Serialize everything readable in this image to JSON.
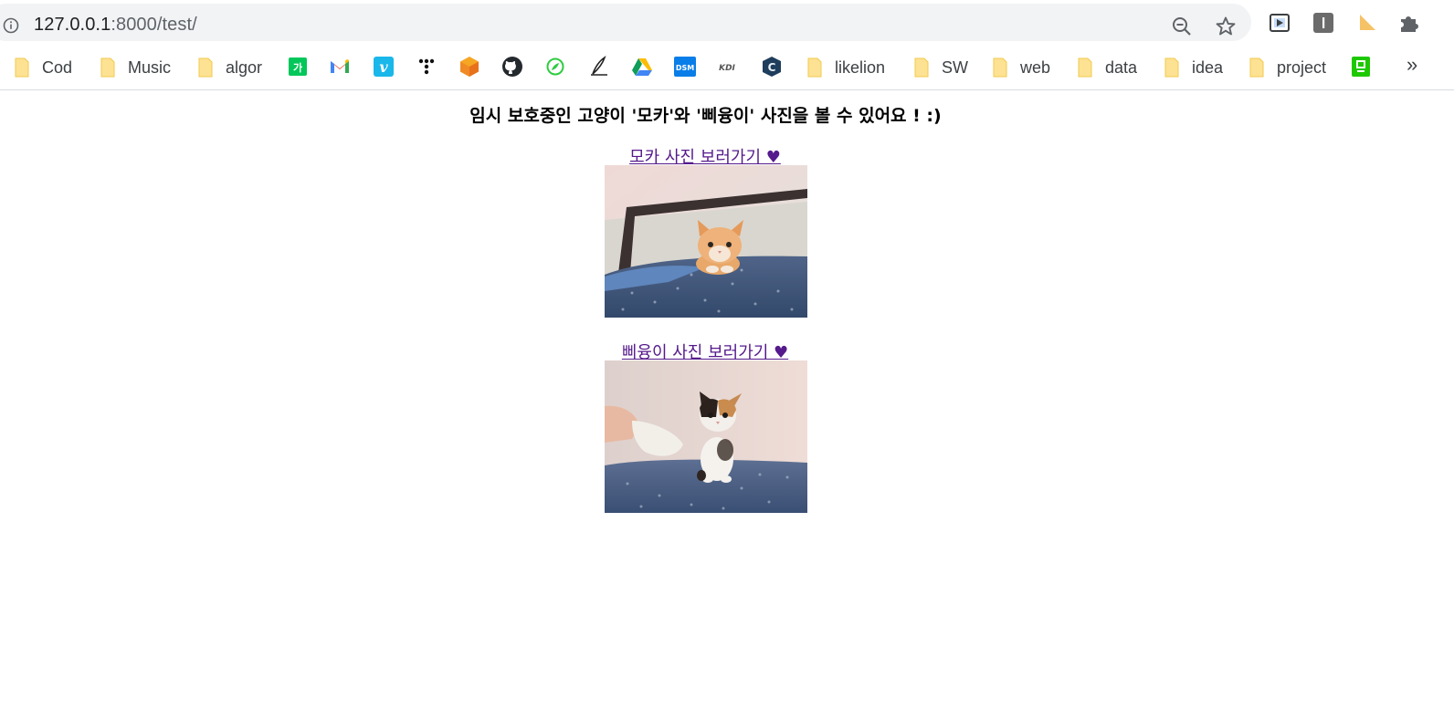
{
  "browser": {
    "url_host": "127.0.0.1",
    "url_rest": ":8000/test/",
    "toolbar_icons": [
      "zoom-out-icon",
      "bookmark-star-icon"
    ],
    "extension_icons": [
      "media-extension-icon",
      "i-extension-icon",
      "triangle-extension-icon",
      "puzzle-extensions-icon"
    ]
  },
  "bookmarks": {
    "items": [
      {
        "label": "Cod",
        "type": "folder"
      },
      {
        "label": "Music",
        "type": "folder"
      },
      {
        "label": "algor",
        "type": "folder"
      },
      {
        "label": "",
        "type": "site",
        "icon": "naver-dictionary-icon"
      },
      {
        "label": "",
        "type": "site",
        "icon": "gmail-icon"
      },
      {
        "label": "",
        "type": "site",
        "icon": "vimeo-icon"
      },
      {
        "label": "",
        "type": "site",
        "icon": "dots-icon"
      },
      {
        "label": "",
        "type": "site",
        "icon": "orange-cube-icon"
      },
      {
        "label": "",
        "type": "site",
        "icon": "github-icon"
      },
      {
        "label": "",
        "type": "site",
        "icon": "green-leaf-icon"
      },
      {
        "label": "",
        "type": "site",
        "icon": "pen-icon"
      },
      {
        "label": "",
        "type": "site",
        "icon": "google-drive-icon"
      },
      {
        "label": "",
        "type": "site",
        "icon": "dsm-icon"
      },
      {
        "label": "",
        "type": "site",
        "icon": "kdi-icon"
      },
      {
        "label": "",
        "type": "site",
        "icon": "c-cube-icon"
      },
      {
        "label": "likelion",
        "type": "folder"
      },
      {
        "label": "SW",
        "type": "folder"
      },
      {
        "label": "web",
        "type": "folder"
      },
      {
        "label": "data",
        "type": "folder"
      },
      {
        "label": "idea",
        "type": "folder"
      },
      {
        "label": "project",
        "type": "folder"
      },
      {
        "label": "",
        "type": "site",
        "icon": "green-square-icon"
      }
    ],
    "overflow": "»",
    "kdi_text": "KDI",
    "dsm_text": "DSM",
    "naver_text": "가"
  },
  "page": {
    "title": "임시 보호중인 고양이 '모카'와 '삐융이' 사진을 볼 수 있어요 ! :)",
    "links": [
      {
        "label": "모카 사진 보러가기 ♥",
        "image": "mocha-kitten-photo"
      },
      {
        "label": "삐융이 사진 보러가기 ♥",
        "image": "bbiyung-kitten-photo"
      }
    ]
  }
}
